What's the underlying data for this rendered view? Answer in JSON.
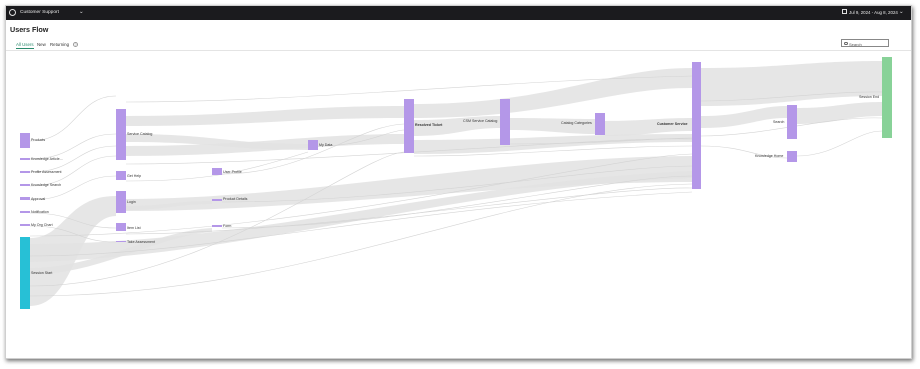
{
  "header": {
    "workspace": "Customer Support",
    "date_range": "Jul 9, 2024 - Aug 8, 2024",
    "icons": {
      "logo": "logo-icon",
      "workspace_dropdown": "chevron-down-icon",
      "calendar": "calendar-icon",
      "date_dropdown": "chevron-down-icon"
    }
  },
  "page": {
    "title": "Users Flow"
  },
  "tabs": [
    {
      "label": "All Users",
      "active": true
    },
    {
      "label": "New",
      "active": false
    },
    {
      "label": "Returning",
      "active": false
    }
  ],
  "search": {
    "placeholder": "Search"
  },
  "colors": {
    "node": "#b497e8",
    "start": "#27c0d6",
    "end": "#88d298",
    "flow": "#e2e2e2",
    "tab_active": "#2a8a6c"
  },
  "nodes": {
    "products": "Products",
    "knowledge_article": "Knowledge Article...",
    "profile_assessment": "Profile Assessment",
    "knowledge_search": "Knowledge Search",
    "approval": "Approval",
    "notification": "Notification",
    "my_org_chart": "My Org Chart",
    "session_start": "Session Start",
    "service_catalog": "Service Catalog",
    "get_help": "Get Help",
    "login": "Login",
    "item_list": "Item List",
    "take_assessment": "Take Assessment",
    "user_profile": "User Profile",
    "product_details": "Product Details",
    "form": "Form",
    "my_data": "My Data",
    "resolved_ticket": "Resolved Ticket",
    "csm_service_catalog": "CSM Service Catalog",
    "catalog_categories": "Catalog Categories",
    "customer_service": "Customer Service",
    "search": "Search",
    "knowledge_home": "Knowledge Home",
    "session_end": "Session End"
  }
}
